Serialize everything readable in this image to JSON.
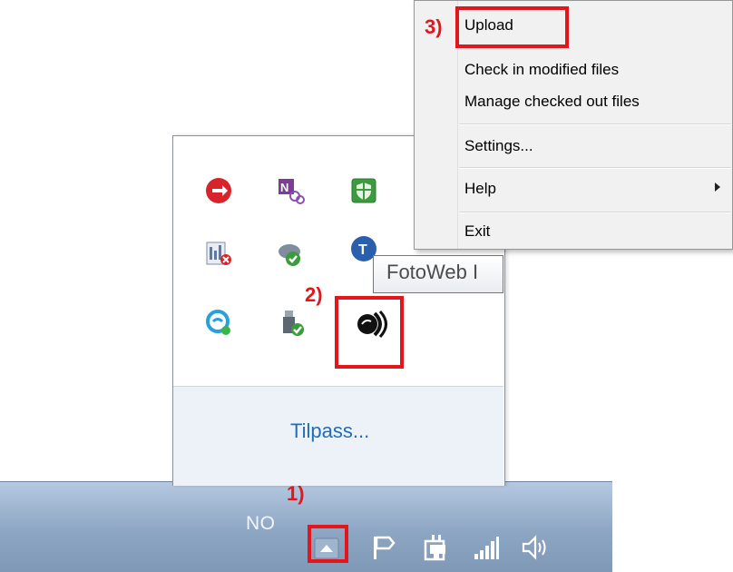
{
  "context_menu": {
    "items": [
      {
        "label": "Upload"
      },
      {
        "label": "Check in modified files"
      },
      {
        "label": "Manage checked out files"
      },
      {
        "label": "Settings..."
      },
      {
        "label": "Help"
      },
      {
        "label": "Exit"
      }
    ]
  },
  "tray_popup": {
    "tooltip": "FotoWeb I",
    "customize_link": "Tilpass...",
    "icons": [
      "red-ribbon-icon",
      "onenote-clip-icon",
      "green-shield-icon",
      "meter-calendar-icon",
      "cloud-check-icon",
      "blue-circle-app-icon",
      "chat-bubble-icon",
      "usb-safe-remove-icon",
      "fotoweb-icon"
    ]
  },
  "taskbar": {
    "language": "NO",
    "icons": [
      "show-hidden-icons-arrow",
      "action-center-flag-icon",
      "power-plug-icon",
      "network-signal-icon",
      "volume-icon"
    ]
  },
  "annotations": {
    "step1": "1)",
    "step2": "2)",
    "step3": "3)",
    "highlight_color": "#e4161c"
  },
  "colors": {
    "link": "#1f6dbb",
    "taskbar": "#8da6c3"
  }
}
